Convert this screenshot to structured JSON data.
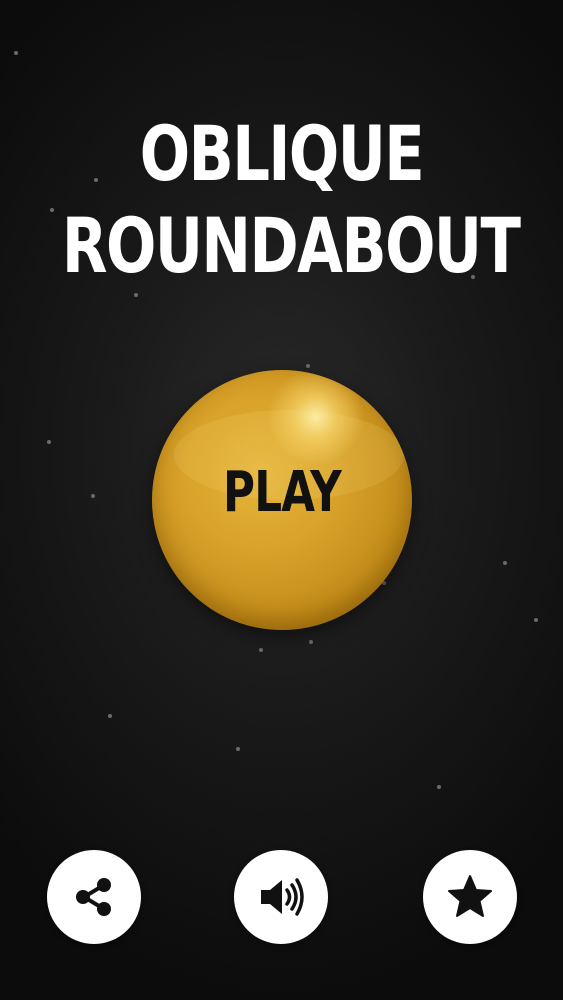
{
  "title": {
    "line1": "OBLIQUE",
    "line2": "ROUNDABOUT"
  },
  "play_button": {
    "label": "PLAY",
    "color": "#d9a22a"
  },
  "bottom_buttons": [
    {
      "name": "share-button",
      "icon": "share-icon"
    },
    {
      "name": "sound-button",
      "icon": "speaker-icon"
    },
    {
      "name": "rate-button",
      "icon": "star-icon"
    }
  ],
  "colors": {
    "background": "#1a1a1a",
    "title": "#ffffff",
    "button_bg": "#ffffff",
    "icon": "#111111"
  }
}
